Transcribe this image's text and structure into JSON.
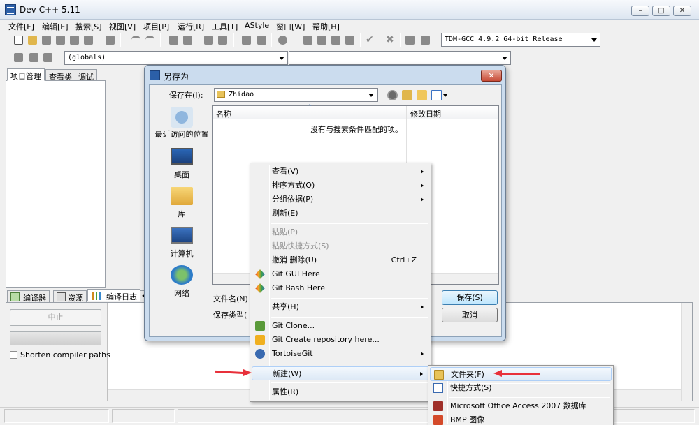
{
  "app": {
    "title": "Dev-C++ 5.11",
    "min": "–",
    "max": "□",
    "close": "✕"
  },
  "menus": [
    "文件[F]",
    "编辑[E]",
    "搜索[S]",
    "视图[V]",
    "项目[P]",
    "运行[R]",
    "工具[T]",
    "AStyle",
    "窗口[W]",
    "帮助[H]"
  ],
  "toolbar": {
    "compiler_combo": "TDM-GCC 4.9.2 64-bit Release",
    "scope_combo": "(globals)",
    "symbol_combo": ""
  },
  "left_tabs": [
    "项目管理",
    "查看类",
    "调试"
  ],
  "bottom_tabs": [
    "编译器",
    "资源",
    "编译日志"
  ],
  "bottom_tab_more": "◀",
  "compile": {
    "abort_label": "中止",
    "shorten_label": "Shorten compiler paths"
  },
  "dialog": {
    "title": "另存为",
    "close": "✕",
    "save_in_label": "保存在(I):",
    "save_in_value": "Zhidao",
    "places": [
      "最近访问的位置",
      "桌面",
      "库",
      "计算机",
      "网络"
    ],
    "columns": {
      "name": "名称",
      "date": "修改日期"
    },
    "sort_indicator": "^",
    "empty_message": "没有与搜索条件匹配的项。",
    "filename_label": "文件名(N)",
    "filetype_label": "保存类型(",
    "save_button": "保存(S)",
    "cancel_button": "取消"
  },
  "context_menu": {
    "items": [
      {
        "label": "查看(V)"
      },
      {
        "label": "排序方式(O)"
      },
      {
        "label": "分组依据(P)"
      },
      {
        "label": "刷新(E)"
      },
      {
        "label": "粘贴(P)"
      },
      {
        "label": "粘贴快捷方式(S)"
      },
      {
        "label": "撤消 删除(U)",
        "shortcut": "Ctrl+Z"
      },
      {
        "label": "Git GUI Here"
      },
      {
        "label": "Git Bash Here"
      },
      {
        "label": "共享(H)"
      },
      {
        "label": "Git Clone..."
      },
      {
        "label": "Git Create repository here..."
      },
      {
        "label": "TortoiseGit"
      },
      {
        "label": "新建(W)"
      },
      {
        "label": "属性(R)"
      }
    ]
  },
  "submenu": {
    "items": [
      {
        "label": "文件夹(F)"
      },
      {
        "label": "快捷方式(S)"
      },
      {
        "label": "Microsoft Office Access 2007 数据库"
      },
      {
        "label": "BMP 图像"
      }
    ]
  },
  "colors": {
    "accent_highlight": "#dde9f6",
    "arrow": "#e8303a",
    "titlebar": "#dde6f1"
  }
}
